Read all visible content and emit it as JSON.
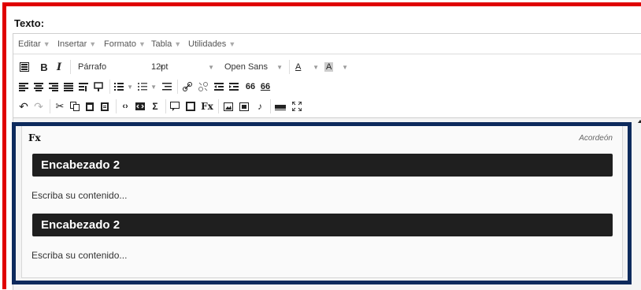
{
  "field": {
    "label": "Texto:"
  },
  "menubar": {
    "items": [
      {
        "label": "Editar"
      },
      {
        "label": "Insertar"
      },
      {
        "label": "Formato"
      },
      {
        "label": "Tabla"
      },
      {
        "label": "Utilidades"
      }
    ]
  },
  "toolbar": {
    "bold_label": "B",
    "italic_label": "I",
    "block_format": "Párrafo",
    "font_size": "12pt",
    "font_family": "Open Sans",
    "text_color_label": "A",
    "bg_color_label": "A",
    "formula_label": "Fx",
    "sigma_label": "Σ",
    "quote_label": "66",
    "quote2_label": "66"
  },
  "colors": {
    "outer_border": "#e00000",
    "accordion_border": "#0d2a5c",
    "heading_bg": "#1f1f1f"
  },
  "accordion": {
    "formula_icon": "Fx",
    "type_label": "Acordeón",
    "sections": [
      {
        "heading": "Encabezado 2",
        "body": "Escriba su contenido..."
      },
      {
        "heading": "Encabezado 2",
        "body": "Escriba su contenido..."
      }
    ]
  }
}
